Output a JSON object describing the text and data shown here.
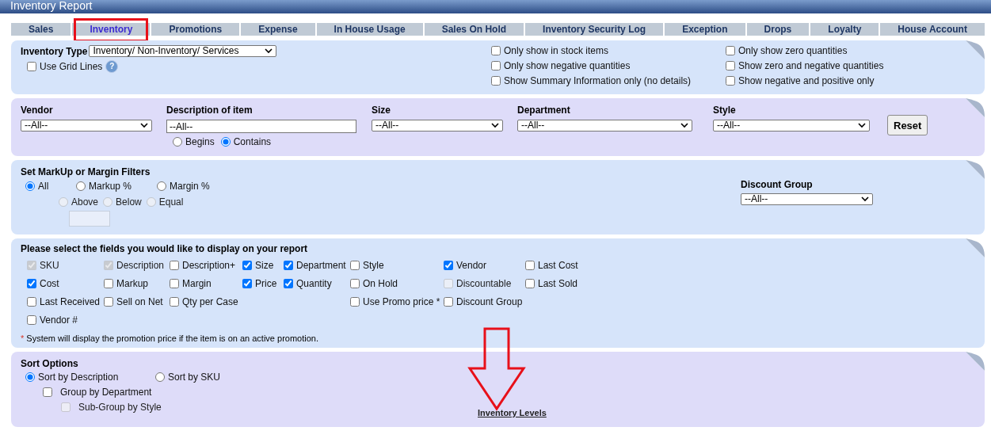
{
  "window": {
    "title": "Inventory Report"
  },
  "tabs": [
    {
      "label": "Sales",
      "selected": false,
      "highlighted": false
    },
    {
      "label": "Inventory",
      "selected": true,
      "highlighted": true
    },
    {
      "label": "Promotions",
      "selected": false,
      "highlighted": false
    },
    {
      "label": "Expense",
      "selected": false,
      "highlighted": false
    },
    {
      "label": "In House Usage",
      "selected": false,
      "highlighted": false
    },
    {
      "label": "Sales On Hold",
      "selected": false,
      "highlighted": false
    },
    {
      "label": "Inventory Security Log",
      "selected": false,
      "highlighted": false
    },
    {
      "label": "Exception",
      "selected": false,
      "highlighted": false
    },
    {
      "label": "Drops",
      "selected": false,
      "highlighted": false
    },
    {
      "label": "Loyalty",
      "selected": false,
      "highlighted": false
    },
    {
      "label": "House Account",
      "selected": false,
      "highlighted": false
    }
  ],
  "type_panel": {
    "label": "Inventory Type",
    "value": "Inventory/ Non-Inventory/ Services",
    "grid_lines": {
      "label": "Use Grid Lines",
      "checked": false
    },
    "help": "?",
    "options": [
      [
        {
          "label": "Only show in stock items",
          "checked": false
        },
        {
          "label": "Only show negative quantities",
          "checked": false
        },
        {
          "label": "Show Summary Information only (no details)",
          "checked": false
        }
      ],
      [
        {
          "label": "Only show zero quantities",
          "checked": false
        },
        {
          "label": "Show zero and negative quantities",
          "checked": false
        },
        {
          "label": "Show negative and positive only",
          "checked": false
        }
      ]
    ]
  },
  "filter_panel": {
    "filters": [
      {
        "label": "Vendor",
        "kind": "dropdown",
        "value": "--All--"
      },
      {
        "label": "Description of item",
        "kind": "text",
        "value": "--All--",
        "match": [
          {
            "label": "Begins",
            "selected": false
          },
          {
            "label": "Contains",
            "selected": true
          }
        ]
      },
      {
        "label": "Size",
        "kind": "dropdown",
        "value": "--All--"
      },
      {
        "label": "Department",
        "kind": "dropdown",
        "value": "--All--"
      },
      {
        "label": "Style",
        "kind": "dropdown",
        "value": "--All--"
      }
    ],
    "button": "Reset"
  },
  "markup_panel": {
    "title": "Set MarkUp or Margin Filters",
    "modes": [
      {
        "label": "All",
        "selected": true
      },
      {
        "label": "Markup %",
        "selected": false
      },
      {
        "label": "Margin %",
        "selected": false
      }
    ],
    "comparisons": [
      {
        "label": "Above",
        "selected": false,
        "disabled": true
      },
      {
        "label": "Below",
        "selected": false,
        "disabled": true
      },
      {
        "label": "Equal",
        "selected": false,
        "disabled": true
      }
    ],
    "discount_group": {
      "label": "Discount Group",
      "value": "--All--"
    }
  },
  "fields_panel": {
    "title": "Please select the fields you would like to display on your report",
    "rows": [
      [
        {
          "label": "SKU",
          "checked": true,
          "disabled": true
        },
        {
          "label": "Description",
          "checked": true,
          "disabled": true
        },
        {
          "label": "Description+",
          "checked": false,
          "disabled": false
        },
        {
          "label": "Size",
          "checked": true,
          "disabled": false
        },
        {
          "label": "Department",
          "checked": true,
          "disabled": false
        },
        {
          "label": "Style",
          "checked": false,
          "disabled": false
        },
        {
          "label": "Vendor",
          "checked": true,
          "disabled": false
        },
        {
          "label": "Last Cost",
          "checked": false,
          "disabled": false
        }
      ],
      [
        {
          "label": "Cost",
          "checked": true,
          "disabled": false
        },
        {
          "label": "Markup",
          "checked": false,
          "disabled": false
        },
        {
          "label": "Margin",
          "checked": false,
          "disabled": false
        },
        {
          "label": "Price",
          "checked": true,
          "disabled": false
        },
        {
          "label": "Quantity",
          "checked": true,
          "disabled": false
        },
        {
          "label": "On Hold",
          "checked": false,
          "disabled": false
        },
        {
          "label": "Discountable",
          "checked": false,
          "disabled": true
        },
        {
          "label": "Last Sold",
          "checked": false,
          "disabled": false
        }
      ],
      [
        {
          "label": "Last Received",
          "checked": false,
          "disabled": false
        },
        {
          "label": "Sell on Net",
          "checked": false,
          "disabled": false
        },
        {
          "label": "Qty per Case",
          "checked": false,
          "disabled": false
        },
        null,
        null,
        {
          "label": "Use Promo price *",
          "checked": false,
          "disabled": false
        },
        {
          "label": "Discount Group",
          "checked": false,
          "disabled": false
        },
        null
      ],
      [
        {
          "label": "Vendor #",
          "checked": false,
          "disabled": false
        }
      ]
    ],
    "footnote": {
      "mark": "*",
      "text": "System will display the promotion price if the item is on an active promotion."
    }
  },
  "sort_panel": {
    "title": "Sort Options",
    "sorts": [
      {
        "label": "Sort by Description",
        "selected": true
      },
      {
        "label": "Sort by SKU",
        "selected": false
      }
    ],
    "group": {
      "label": "Group by Department",
      "checked": false,
      "disabled": false
    },
    "subgroup": {
      "label": "Sub-Group by Style",
      "checked": false,
      "disabled": true
    },
    "link": "Inventory Levels"
  },
  "annotations": [
    {
      "kind": "arrow"
    }
  ]
}
